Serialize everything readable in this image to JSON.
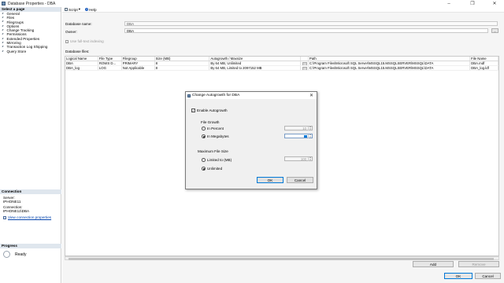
{
  "window": {
    "title": "Database Properties - DBA"
  },
  "left_pane": {
    "select_page_header": "Select a page",
    "pages": [
      "General",
      "Files",
      "Filegroups",
      "Options",
      "Change Tracking",
      "Permissions",
      "Extended Properties",
      "Mirroring",
      "Transaction Log Shipping",
      "Query Store"
    ],
    "connection_header": "Connection",
    "server_label": "Server:",
    "server_value": "IPHONE11",
    "connection_label": "Connection:",
    "connection_value": "IPHONE11\\DBA",
    "view_connection_link": "View connection properties",
    "progress_header": "Progress",
    "progress_status": "Ready"
  },
  "toolbar": {
    "script_label": "Script",
    "help_label": "Help"
  },
  "form": {
    "db_name_label": "Database name:",
    "db_name_value": "DBA",
    "owner_label": "Owner:",
    "owner_value": "DBA",
    "ellipsis": "...",
    "fulltext_label": "Use full-text indexing",
    "files_label": "Database files:"
  },
  "grid": {
    "columns": [
      "Logical Name",
      "File Type",
      "Filegroup",
      "Size (MB)",
      "Autogrowth / Maxsize",
      "",
      "Path",
      "File Name"
    ],
    "rows": [
      [
        "DBA",
        "ROWS D...",
        "PRIMARY",
        "8",
        "By 64 MB, Unlimited",
        "",
        "C:\\Program Files\\Microsoft SQL Server\\MSSQL15.MSSQLSERVER\\MSSQL\\DATA",
        "DBA.mdf"
      ],
      [
        "DBA_log",
        "LOG",
        "Not Applicable",
        "8",
        "By 64 MB, Limited to 2097152 MB",
        "",
        "C:\\Program Files\\Microsoft SQL Server\\MSSQL15.MSSQLSERVER\\MSSQL\\DATA",
        "DBA_log.ldf"
      ]
    ]
  },
  "buttons": {
    "add": "Add",
    "remove": "Remove",
    "ok": "OK",
    "cancel": "Cancel"
  },
  "dialog": {
    "title": "Change Autogrowth for DBA",
    "enable_label": "Enable Autogrowth",
    "enable_checked": true,
    "file_growth_label": "File Growth",
    "in_percent_label": "In Percent",
    "in_percent_value": "10",
    "in_mb_label": "In Megabytes",
    "in_mb_value": "",
    "max_size_label": "Maximum File Size",
    "limited_label": "Limited to (MB)",
    "limited_value": "100",
    "unlimited_label": "Unlimited",
    "ok_label": "OK",
    "cancel_label": "Cancel"
  },
  "colors": {
    "accent": "#0078d7",
    "section_header": "#dfe6ee",
    "link": "#0645ad"
  },
  "icons": [
    "database-icon",
    "page-icon",
    "script-icon",
    "help-icon",
    "connection-icon",
    "progress-icon",
    "close-icon",
    "minimize-icon",
    "maximize-icon"
  ]
}
